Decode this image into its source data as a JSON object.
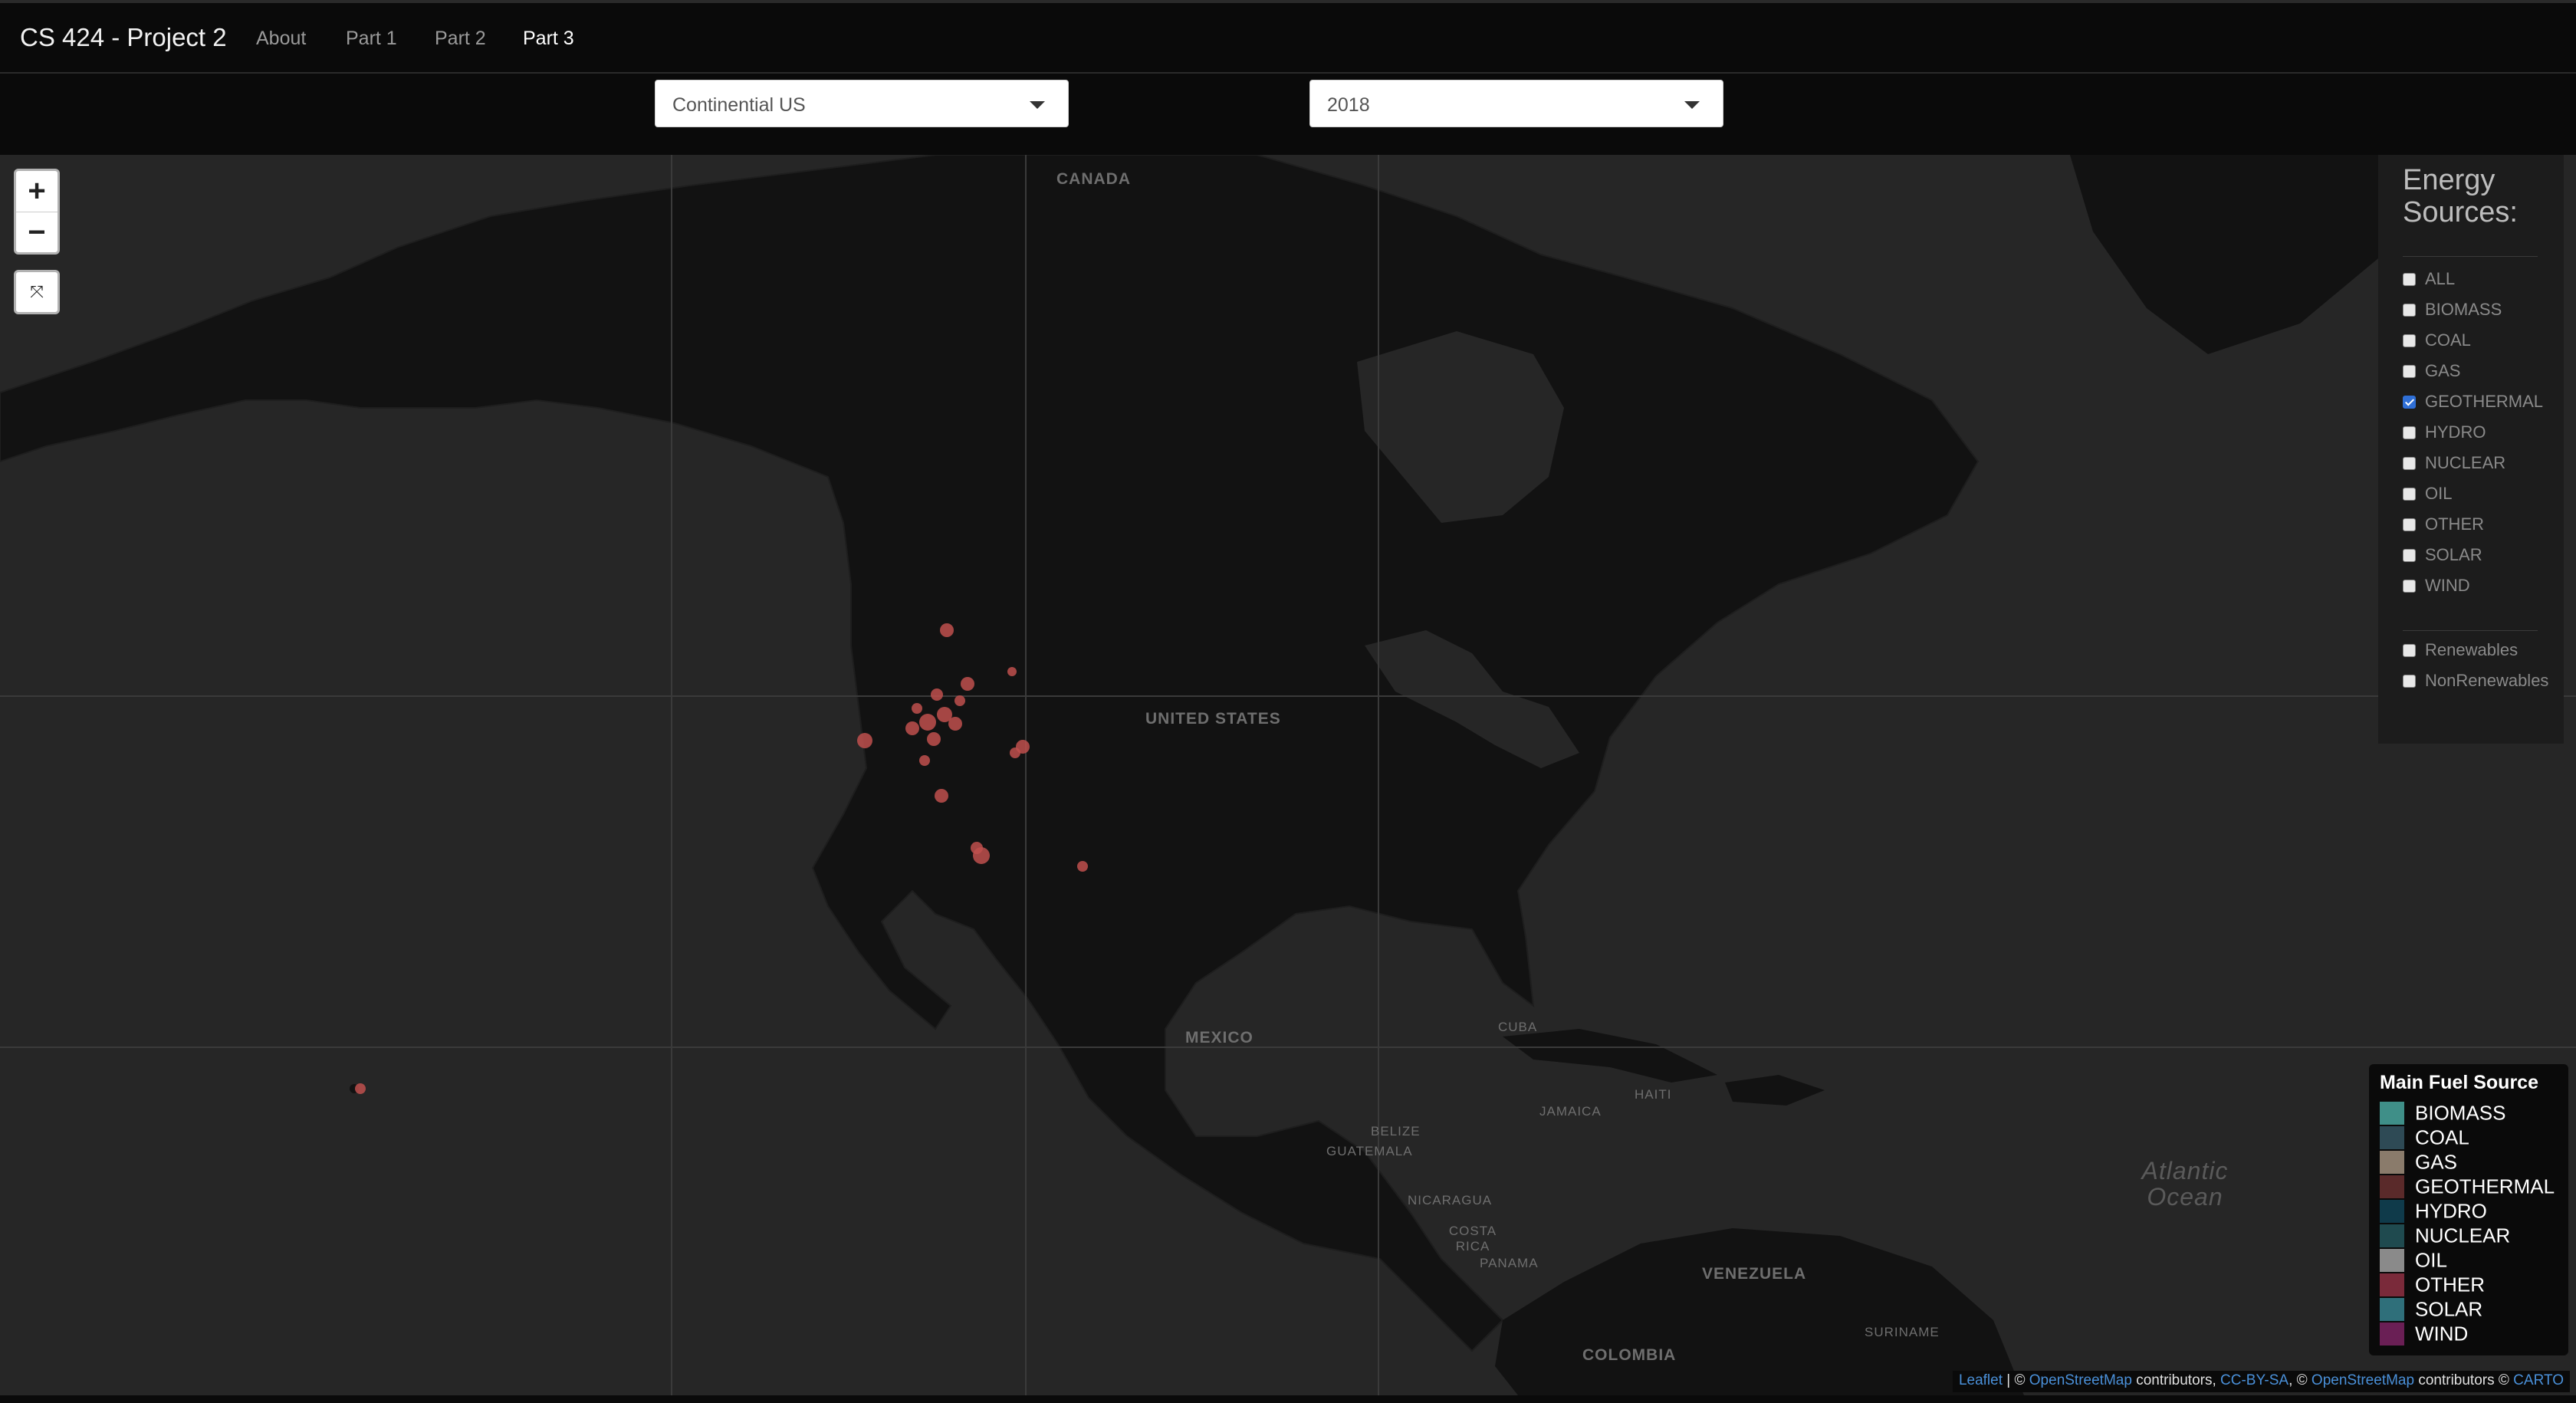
{
  "navbar": {
    "brand": "CS 424 - Project 2",
    "items": [
      {
        "label": "About",
        "active": false
      },
      {
        "label": "Part 1",
        "active": false
      },
      {
        "label": "Part 2",
        "active": false
      },
      {
        "label": "Part 3",
        "active": true
      }
    ]
  },
  "filters": {
    "region": {
      "value": "Continential US"
    },
    "year": {
      "value": "2018"
    }
  },
  "map": {
    "zoom_in": "+",
    "zoom_out": "−",
    "fit_icon": "fit-bounds-icon",
    "labels": {
      "canada": "CANADA",
      "united_states": "UNITED STATES",
      "mexico": "MEXICO",
      "cuba": "CUBA",
      "haiti": "HAITI",
      "jamaica": "JAMAICA",
      "belize": "BELIZE",
      "guatemala": "GUATEMALA",
      "nicaragua": "NICARAGUA",
      "costa_rica": "COSTA RICA",
      "panama": "PANAMA",
      "venezuela": "VENEZUELA",
      "colombia": "COLOMBIA",
      "suriname": "SURINAME",
      "atlantic": "Atlantic Ocean"
    },
    "marker_color": "#c0504d"
  },
  "energy_panel": {
    "title": "Energy Sources:",
    "sources": [
      {
        "label": "ALL",
        "checked": false
      },
      {
        "label": "BIOMASS",
        "checked": false
      },
      {
        "label": "COAL",
        "checked": false
      },
      {
        "label": "GAS",
        "checked": false
      },
      {
        "label": "GEOTHERMAL",
        "checked": true
      },
      {
        "label": "HYDRO",
        "checked": false
      },
      {
        "label": "NUCLEAR",
        "checked": false
      },
      {
        "label": "OIL",
        "checked": false
      },
      {
        "label": "OTHER",
        "checked": false
      },
      {
        "label": "SOLAR",
        "checked": false
      },
      {
        "label": "WIND",
        "checked": false
      }
    ],
    "groups": [
      {
        "label": "Renewables",
        "checked": false
      },
      {
        "label": "NonRenewables",
        "checked": false
      }
    ]
  },
  "fuel_legend": {
    "title": "Main Fuel Source",
    "items": [
      {
        "label": "BIOMASS",
        "color": "#3f8f88"
      },
      {
        "label": "COAL",
        "color": "#2e4a55"
      },
      {
        "label": "GAS",
        "color": "#8a7b6b"
      },
      {
        "label": "GEOTHERMAL",
        "color": "#5a2a2a"
      },
      {
        "label": "HYDRO",
        "color": "#0f3a4a"
      },
      {
        "label": "NUCLEAR",
        "color": "#1f4a4f"
      },
      {
        "label": "OIL",
        "color": "#8a8a8a"
      },
      {
        "label": "OTHER",
        "color": "#7a2a3a"
      },
      {
        "label": "SOLAR",
        "color": "#2f6f7a"
      },
      {
        "label": "WIND",
        "color": "#6a1f55"
      }
    ]
  },
  "attribution": {
    "leaflet": "Leaflet",
    "sep1": " | © ",
    "osm1": "OpenStreetMap",
    "mid1": " contributors, ",
    "ccbysa": "CC-BY-SA",
    "mid2": ", © ",
    "osm2": "OpenStreetMap",
    "mid3": " contributors © ",
    "carto": "CARTO"
  }
}
